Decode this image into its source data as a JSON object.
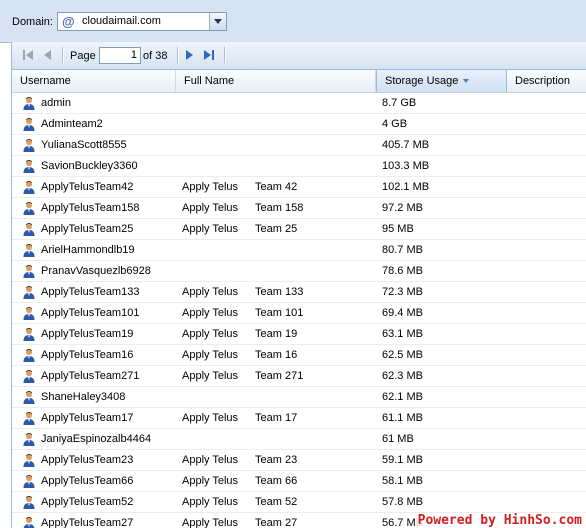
{
  "domain": {
    "label": "Domain:",
    "value": "cloudaimail.com",
    "icon": "at-sign-icon"
  },
  "pager": {
    "page_label": "Page",
    "page_value": "1",
    "of_label": "of 38"
  },
  "columns": {
    "username": "Username",
    "full_name": "Full Name",
    "storage_usage": "Storage Usage",
    "description": "Description"
  },
  "sort": {
    "column": "storage_usage",
    "direction": "descending"
  },
  "rows": [
    {
      "username": "admin",
      "first_name": "",
      "last_name": "",
      "storage": "8.7 GB"
    },
    {
      "username": "Adminteam2",
      "first_name": "",
      "last_name": "",
      "storage": "4 GB"
    },
    {
      "username": "YulianaScott8555",
      "first_name": "",
      "last_name": "",
      "storage": "405.7 MB"
    },
    {
      "username": "SavionBuckley3360",
      "first_name": "",
      "last_name": "",
      "storage": "103.3 MB"
    },
    {
      "username": "ApplyTelusTeam42",
      "first_name": "Apply Telus",
      "last_name": "Team 42",
      "storage": "102.1 MB"
    },
    {
      "username": "ApplyTelusTeam158",
      "first_name": "Apply Telus",
      "last_name": "Team 158",
      "storage": "97.2 MB"
    },
    {
      "username": "ApplyTelusTeam25",
      "first_name": "Apply Telus",
      "last_name": "Team 25",
      "storage": "95 MB"
    },
    {
      "username": "ArielHammondlb19",
      "first_name": "",
      "last_name": "",
      "storage": "80.7 MB"
    },
    {
      "username": "PranavVasquezlb6928",
      "first_name": "",
      "last_name": "",
      "storage": "78.6 MB"
    },
    {
      "username": "ApplyTelusTeam133",
      "first_name": "Apply Telus",
      "last_name": "Team 133",
      "storage": "72.3 MB"
    },
    {
      "username": "ApplyTelusTeam101",
      "first_name": "Apply Telus",
      "last_name": "Team 101",
      "storage": "69.4 MB"
    },
    {
      "username": "ApplyTelusTeam19",
      "first_name": "Apply Telus",
      "last_name": "Team 19",
      "storage": "63.1 MB"
    },
    {
      "username": "ApplyTelusTeam16",
      "first_name": "Apply Telus",
      "last_name": "Team 16",
      "storage": "62.5 MB"
    },
    {
      "username": "ApplyTelusTeam271",
      "first_name": "Apply Telus",
      "last_name": "Team 271",
      "storage": "62.3 MB"
    },
    {
      "username": "ShaneHaley3408",
      "first_name": "",
      "last_name": "",
      "storage": "62.1 MB"
    },
    {
      "username": "ApplyTelusTeam17",
      "first_name": "Apply Telus",
      "last_name": "Team 17",
      "storage": "61.1 MB"
    },
    {
      "username": "JaniyaEspinozalb4464",
      "first_name": "",
      "last_name": "",
      "storage": "61 MB"
    },
    {
      "username": "ApplyTelusTeam23",
      "first_name": "Apply Telus",
      "last_name": "Team 23",
      "storage": "59.1 MB"
    },
    {
      "username": "ApplyTelusTeam66",
      "first_name": "Apply Telus",
      "last_name": "Team 66",
      "storage": "58.1 MB"
    },
    {
      "username": "ApplyTelusTeam52",
      "first_name": "Apply Telus",
      "last_name": "Team 52",
      "storage": "57.8 MB"
    },
    {
      "username": "ApplyTelusTeam27",
      "first_name": "Apply Telus",
      "last_name": "Team 27",
      "storage": "56.7 MB"
    }
  ],
  "watermark": "Powered by HinhSo.com",
  "colors": {
    "header_bar": "#d7e3f3",
    "panel_border": "#99bbe8",
    "watermark": "#d31f1f"
  }
}
